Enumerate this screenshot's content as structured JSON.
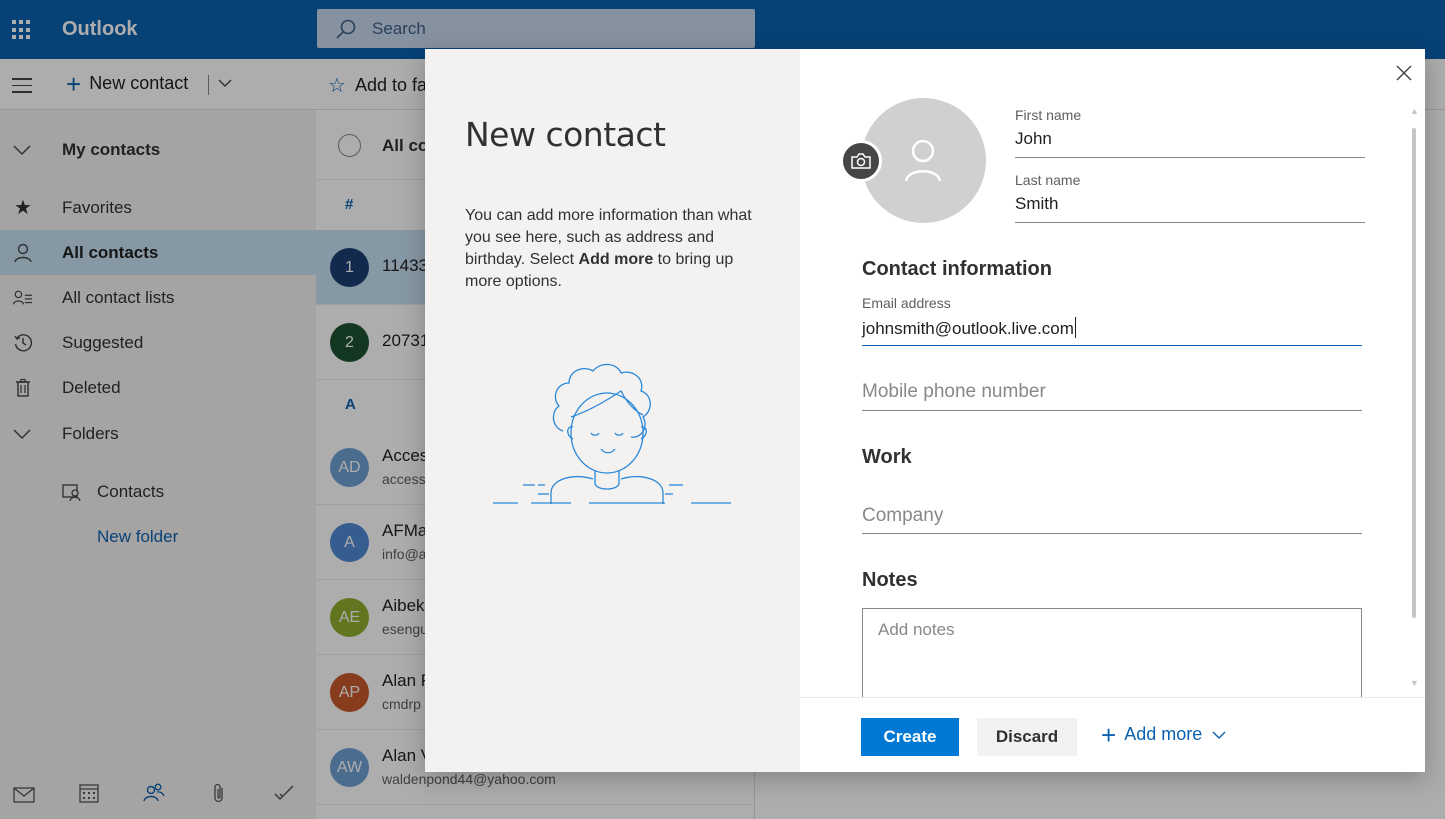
{
  "app": {
    "title": "Outlook"
  },
  "search": {
    "placeholder": "Search"
  },
  "command_bar": {
    "new_contact": "New contact",
    "add_to_favorites": "Add to fa"
  },
  "sidebar": {
    "my_contacts": "My contacts",
    "items": [
      {
        "label": "Favorites",
        "icon": "star-icon"
      },
      {
        "label": "All contacts",
        "icon": "person-icon",
        "selected": true
      },
      {
        "label": "All contact lists",
        "icon": "contact-list-icon"
      },
      {
        "label": "Suggested",
        "icon": "history-icon"
      },
      {
        "label": "Deleted",
        "icon": "trash-icon"
      }
    ],
    "folders": "Folders",
    "folder_items": [
      {
        "label": "Contacts"
      }
    ],
    "new_folder": "New folder"
  },
  "bottom_bar": {
    "icons": [
      "mail-icon",
      "calendar-icon",
      "people-icon",
      "attachment-icon",
      "todo-icon"
    ]
  },
  "contact_list": {
    "header": "All co",
    "groups": [
      {
        "letter": "#",
        "rows": [
          {
            "initials": "1",
            "name": "11433",
            "email": "",
            "color": "#1b3f73",
            "selected": true
          },
          {
            "initials": "2",
            "name": "20731",
            "email": "",
            "color": "#1d5130"
          }
        ]
      },
      {
        "letter": "A",
        "rows": [
          {
            "initials": "AD",
            "name": "Acces",
            "email": "access",
            "color": "#6e9fd1"
          },
          {
            "initials": "A",
            "name": "AFMa",
            "email": "info@a",
            "color": "#4f8ad4"
          },
          {
            "initials": "AE",
            "name": "Aibek",
            "email": "esengu",
            "color": "#8fae2f"
          },
          {
            "initials": "AP",
            "name": "Alan F",
            "email": "cmdrp",
            "color": "#c85a2c"
          },
          {
            "initials": "AW",
            "name": "Alan V",
            "email": "waldenpond44@yahoo.com",
            "color": "#6e9fd1"
          }
        ]
      }
    ]
  },
  "dialog": {
    "title": "New contact",
    "description_part1": "You can add more information than what you see here, such as address and birthday. Select ",
    "description_bold": "Add more",
    "description_part2": " to bring up more options.",
    "first_name_label": "First name",
    "first_name_value": "John",
    "last_name_label": "Last name",
    "last_name_value": "Smith",
    "contact_info_header": "Contact information",
    "email_label": "Email address",
    "email_value": "johnsmith@outlook.live.com",
    "mobile_placeholder": "Mobile phone number",
    "work_header": "Work",
    "company_placeholder": "Company",
    "notes_header": "Notes",
    "notes_placeholder": "Add notes",
    "create_button": "Create",
    "discard_button": "Discard",
    "add_more_button": "Add more"
  },
  "colors": {
    "brand": "#0b62b0",
    "primary_button": "#0078d4",
    "selected_bg": "#c7e0f4"
  }
}
